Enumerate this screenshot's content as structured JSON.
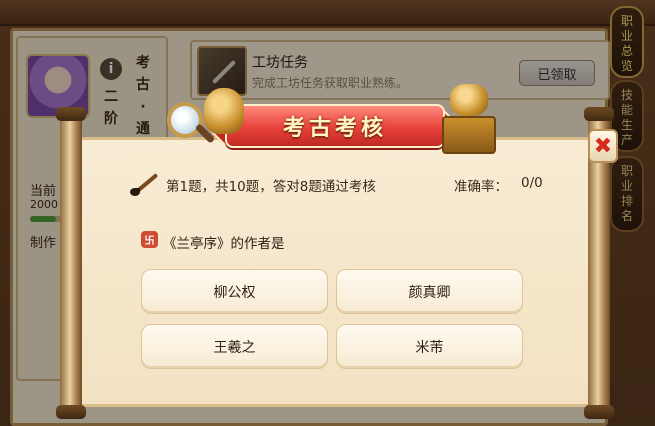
{
  "background": {
    "rank": {
      "chars": [
        "考",
        "古",
        "·",
        "通"
      ]
    },
    "level": {
      "chars": [
        "二",
        "阶"
      ]
    },
    "current_label": "当前",
    "number": "2000",
    "craft_label": "制作",
    "skill_progress": 0.2,
    "task": {
      "title": "工坊任务",
      "desc": "完成工坊任务获取职业熟练。",
      "button": "已领取"
    },
    "side_tabs": [
      {
        "chars": [
          "职",
          "业",
          "总",
          "览"
        ]
      },
      {
        "chars": [
          "技",
          "能",
          "生",
          "产"
        ]
      },
      {
        "chars": [
          "职",
          "业",
          "排",
          "名"
        ]
      }
    ]
  },
  "dialog": {
    "title": "考古考核",
    "progress_text": "第1题，共10题，答对8题通过考核",
    "accuracy_label": "准确率：",
    "accuracy_value": "0/0",
    "question": "《兰亭序》的作者是",
    "options": [
      "柳公权",
      "颜真卿",
      "王羲之",
      "米芾"
    ],
    "close_glyph": "✖",
    "info_glyph": "i"
  },
  "colors": {
    "banner": "#e8423a",
    "paper": "#f3e2c2",
    "close": "#d62a1f"
  }
}
